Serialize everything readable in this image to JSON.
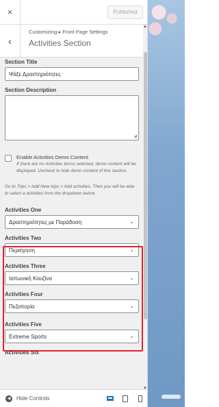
{
  "header": {
    "close_icon": "×",
    "publish_label": "Published",
    "back_icon": "‹",
    "breadcrumb": "Customizing ▸ Front Page Settings",
    "title": "Activities Section"
  },
  "form": {
    "section_title_label": "Section Title",
    "section_title_value": "Ψάξε Δραστηριότητες",
    "section_description_label": "Section Description",
    "section_description_value": "",
    "demo_checkbox_label": "Enable Activities Demo Content",
    "demo_checkbox_checked": false,
    "demo_checkbox_desc": "If there are no Activities terms selected, demo content will be displayed. Uncheck to hide demo content of this section.",
    "instructions": "Go to Trips > Add New trips > Add activities. Then you will be able to select a activities from the dropdown below.",
    "activities": [
      {
        "label": "Activities One",
        "value": "Δραστηριότητες με Παράδοση"
      },
      {
        "label": "Activities Two",
        "value": "Περιήγηση"
      },
      {
        "label": "Activities Three",
        "value": "Ιαπωνική Κουζίνα"
      },
      {
        "label": "Activities Four",
        "value": "Πεζοπορία"
      },
      {
        "label": "Activities Five",
        "value": "Extreme Sports"
      },
      {
        "label": "Activities Six",
        "value": ""
      }
    ]
  },
  "footer": {
    "hide_controls_label": "Hide Controls",
    "devices": [
      "desktop-icon",
      "tablet-icon",
      "mobile-icon"
    ]
  },
  "colors": {
    "highlight": "#e0222b",
    "active_device": "#2271b1"
  }
}
